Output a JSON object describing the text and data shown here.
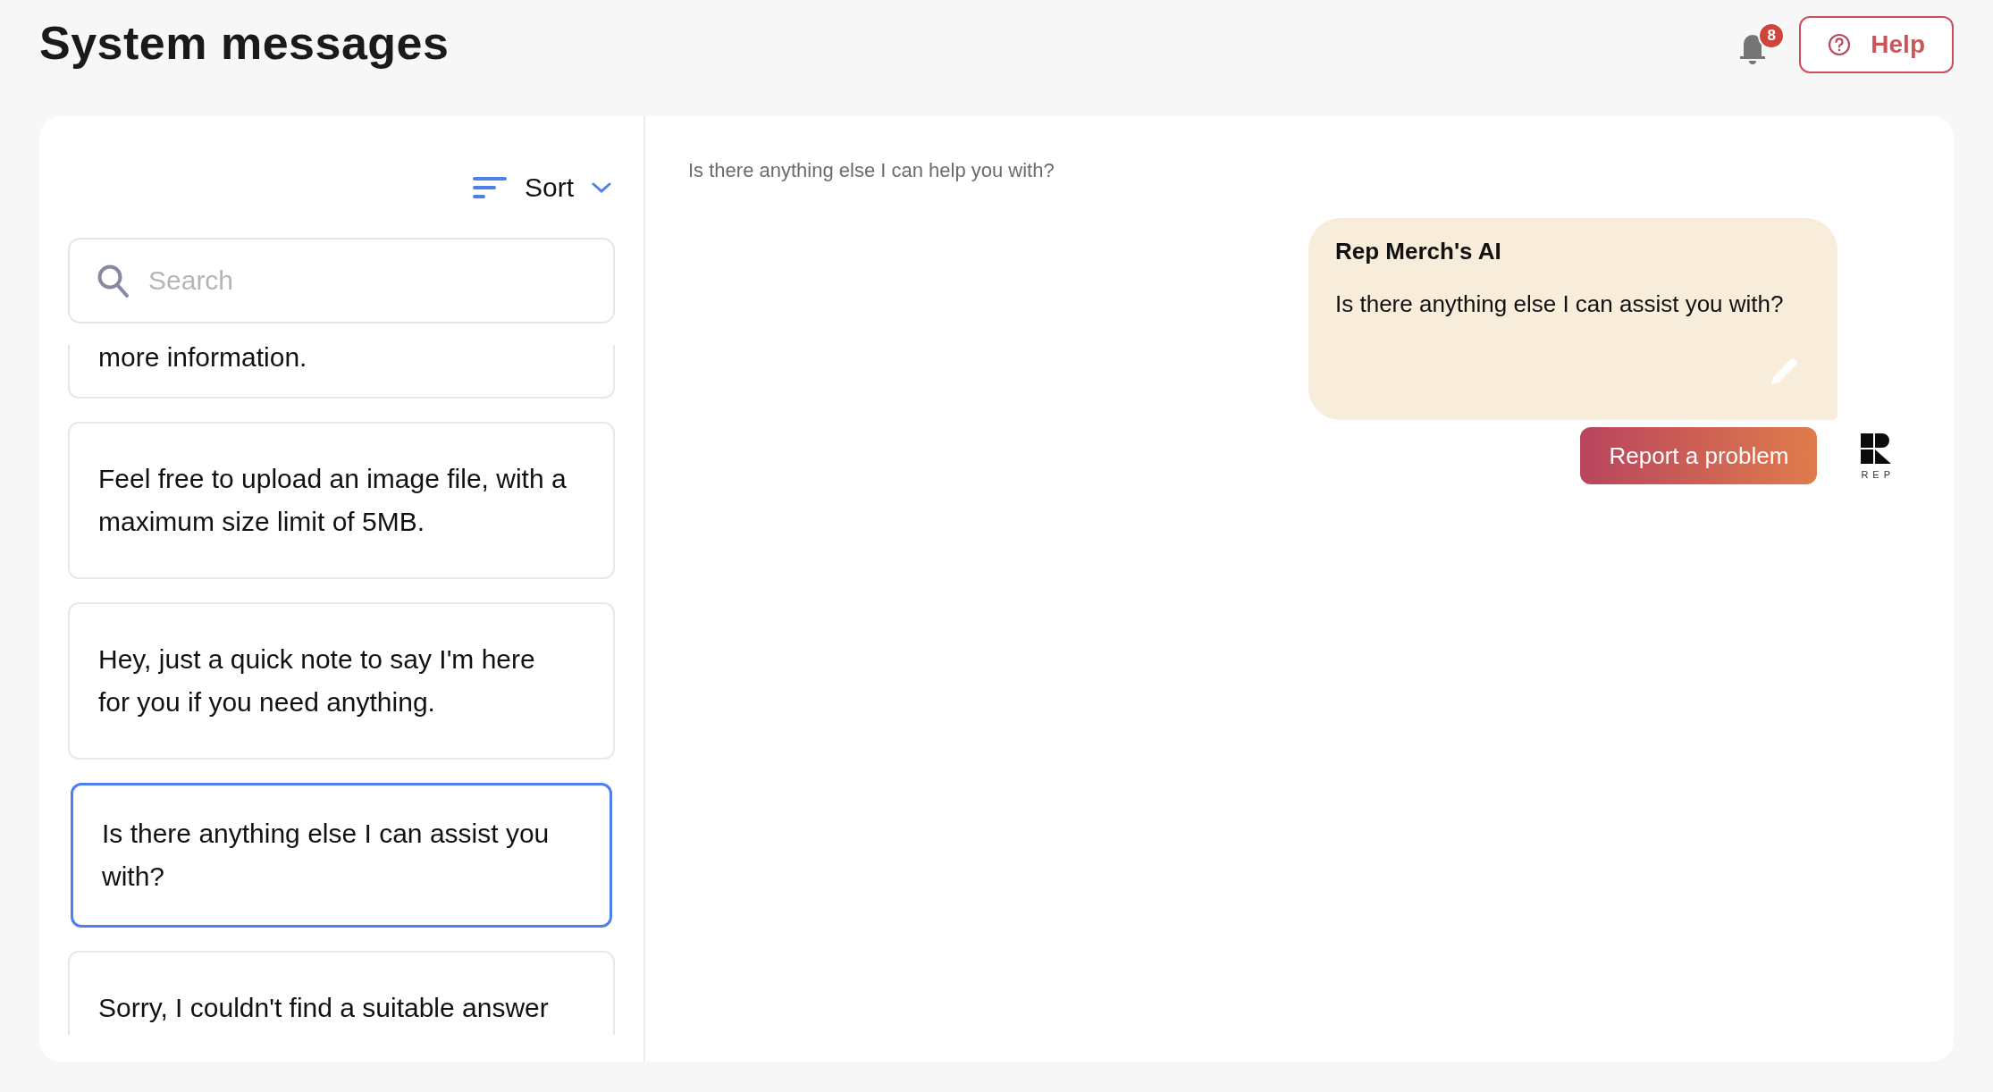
{
  "header": {
    "title": "System messages",
    "notifications": {
      "count": "8"
    },
    "help_button": {
      "label": "Help"
    }
  },
  "sidebar": {
    "sort": {
      "label": "Sort"
    },
    "search": {
      "placeholder": "Search"
    },
    "messages": [
      {
        "text": "more information.",
        "selected": false
      },
      {
        "text": "Feel free to upload an image file, with a maximum size limit of 5MB.",
        "selected": false
      },
      {
        "text": "Hey, just a quick note to say I'm here for you if you need anything.",
        "selected": false
      },
      {
        "text": "Is there anything else I can assist you with?",
        "selected": true
      },
      {
        "text": "Sorry, I couldn't find a suitable answer",
        "selected": false
      }
    ]
  },
  "detail": {
    "subtitle": "Is there anything else I can help you with?",
    "bubble": {
      "sender": "Rep Merch's AI",
      "text": "Is there anything else I can assist you with?"
    },
    "report_button": {
      "label": "Report a problem"
    },
    "logo": {
      "text": "REP"
    }
  }
}
